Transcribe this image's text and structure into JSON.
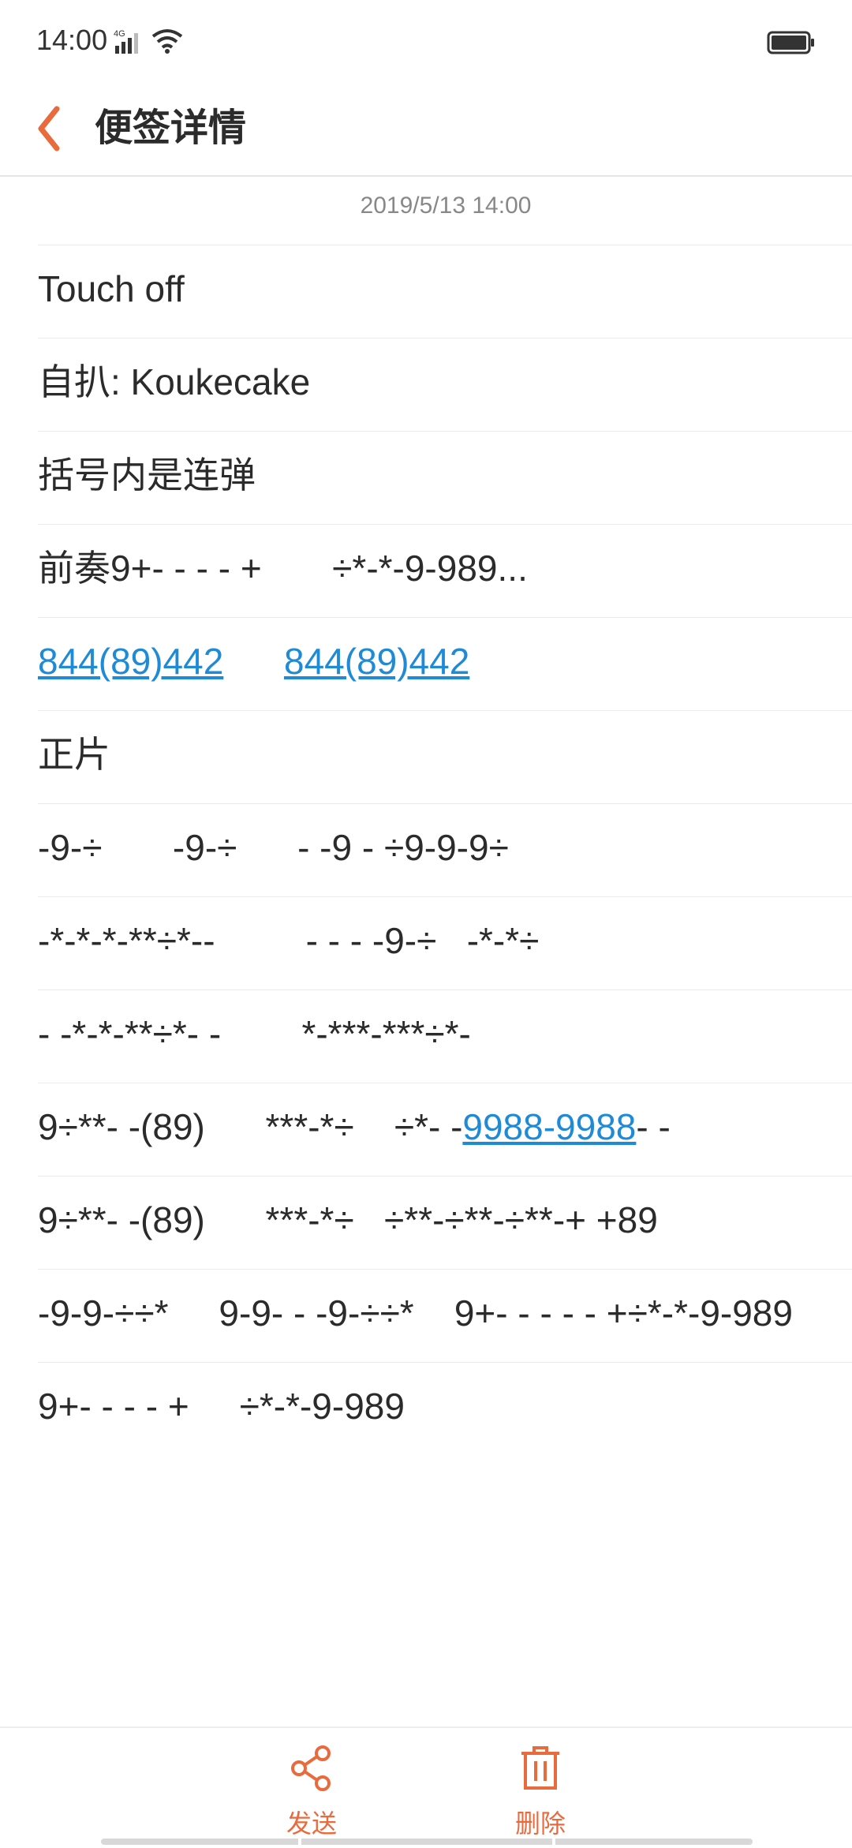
{
  "status": {
    "time": "14:00",
    "network": "4G"
  },
  "header": {
    "title": "便签详情"
  },
  "note": {
    "date": "2019/5/13 14:00",
    "lines": [
      {
        "text": "Touch off"
      },
      {
        "text": "自扒: Koukecake"
      },
      {
        "text": "括号内是连弹"
      },
      {
        "text": "前奏9+- - - - +       ÷*-*-9-989..."
      },
      {
        "link1": "844(89)442",
        "gap": "      ",
        "link2": "844(89)442"
      },
      {
        "text": "正片"
      },
      {
        "text": "-9-÷       -9-÷      - -9 - ÷9-9-9÷"
      },
      {
        "text": "-*-*-*-**÷*--         - - - -9-÷   -*-*÷"
      },
      {
        "text": "- -*-*-**÷*- -        *-***-***÷*-"
      },
      {
        "prefix": "9÷**- -(89)      ***-*÷    ÷*- -",
        "link": "9988-9988",
        "suffix": "- -"
      },
      {
        "text": "9÷**- -(89)      ***-*÷   ÷**-÷**-÷**-+ +89"
      },
      {
        "text": "-9-9-÷÷*     9-9- - -9-÷÷*    9+- - - - - +÷*-*-9-989"
      },
      {
        "text": "9+- - - - +     ÷*-*-9-989"
      }
    ]
  },
  "actions": {
    "send": "发送",
    "delete": "删除"
  },
  "colors": {
    "accent": "#e96a3d",
    "link": "#1f8ad6"
  }
}
